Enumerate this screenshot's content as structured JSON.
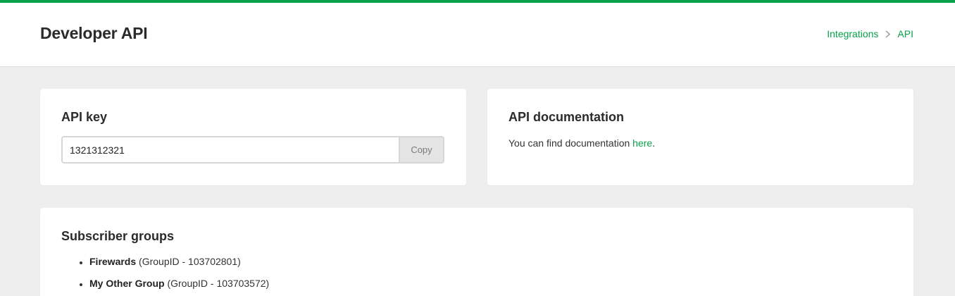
{
  "header": {
    "title": "Developer API",
    "breadcrumb": [
      {
        "label": "Integrations"
      },
      {
        "label": "API"
      }
    ],
    "accent_color": "#09a24a"
  },
  "api_key_card": {
    "title": "API key",
    "key_value": "1321312321",
    "copy_label": "Copy"
  },
  "docs_card": {
    "title": "API documentation",
    "text_before": "You can find documentation ",
    "link_label": "here",
    "text_after": "."
  },
  "groups_card": {
    "title": "Subscriber groups",
    "groups": [
      {
        "name": "Firewards",
        "id_text": "(GroupID - 103702801)"
      },
      {
        "name": "My Other Group",
        "id_text": "(GroupID - 103703572)"
      }
    ]
  },
  "icons": {
    "breadcrumb_separator": "chevron-right-icon"
  }
}
